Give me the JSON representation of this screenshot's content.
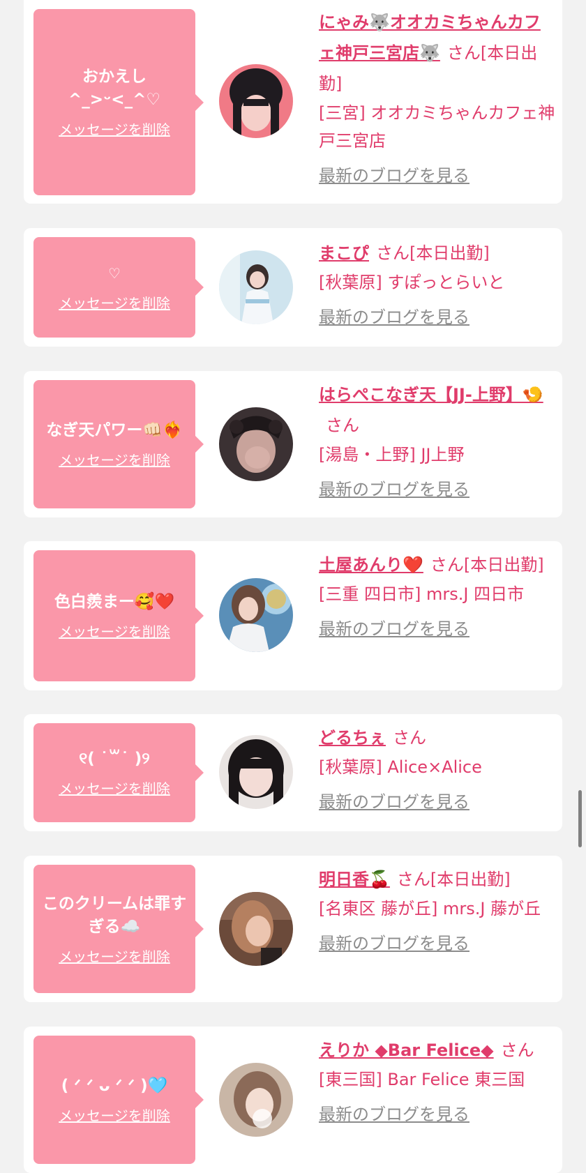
{
  "cards": [
    {
      "message": "おかえし^_>ᵕ<_^♡",
      "delete_label": "メッセージを削除",
      "name": "にゃみ🐺オオカミちゃんカフェ神戸三宮店🐺",
      "honorific": "さん[本日出勤]",
      "shop": "[三宮] オオカミちゃんカフェ神戸三宮店",
      "blog_link": "最新のブログを見る"
    },
    {
      "message": "♡",
      "delete_label": "メッセージを削除",
      "name": "まこぴ",
      "honorific": "さん[本日出勤]",
      "shop": "[秋葉原] すぽっとらいと",
      "blog_link": "最新のブログを見る"
    },
    {
      "message": "なぎ天パワー👊🏻❤️‍🔥",
      "delete_label": "メッセージを削除",
      "name": "はらぺこなぎ天【JJ-上野】🍤",
      "honorific": "さん",
      "shop": "[湯島・上野] JJ上野",
      "blog_link": "最新のブログを見る"
    },
    {
      "message": "色白羨まー🥰❤️",
      "delete_label": "メッセージを削除",
      "name": "土屋あんり❤️",
      "honorific": "さん[本日出勤]",
      "shop": "[三重 四日市] mrs.J 四日市",
      "blog_link": "最新のブログを見る"
    },
    {
      "message": "୧( ˙꒳˙ )୨",
      "delete_label": "メッセージを削除",
      "name": "どるちぇ",
      "honorific": "さん",
      "shop": "[秋葉原] Alice×Alice",
      "blog_link": "最新のブログを見る"
    },
    {
      "message": "このクリームは罪すぎる☁️",
      "delete_label": "メッセージを削除",
      "name": "明日香🍒",
      "honorific": "さん[本日出勤]",
      "shop": "[名東区 藤が丘] mrs.J 藤が丘",
      "blog_link": "最新のブログを見る"
    },
    {
      "message": "( ᐟ ᐟ ᴗ ᐟ ᐟ )🩵",
      "delete_label": "メッセージを削除",
      "name": "えりか ◆Bar Felice◆",
      "honorific": "さん",
      "shop": "[東三国] Bar Felice 東三国",
      "blog_link": "最新のブログを見る"
    }
  ]
}
